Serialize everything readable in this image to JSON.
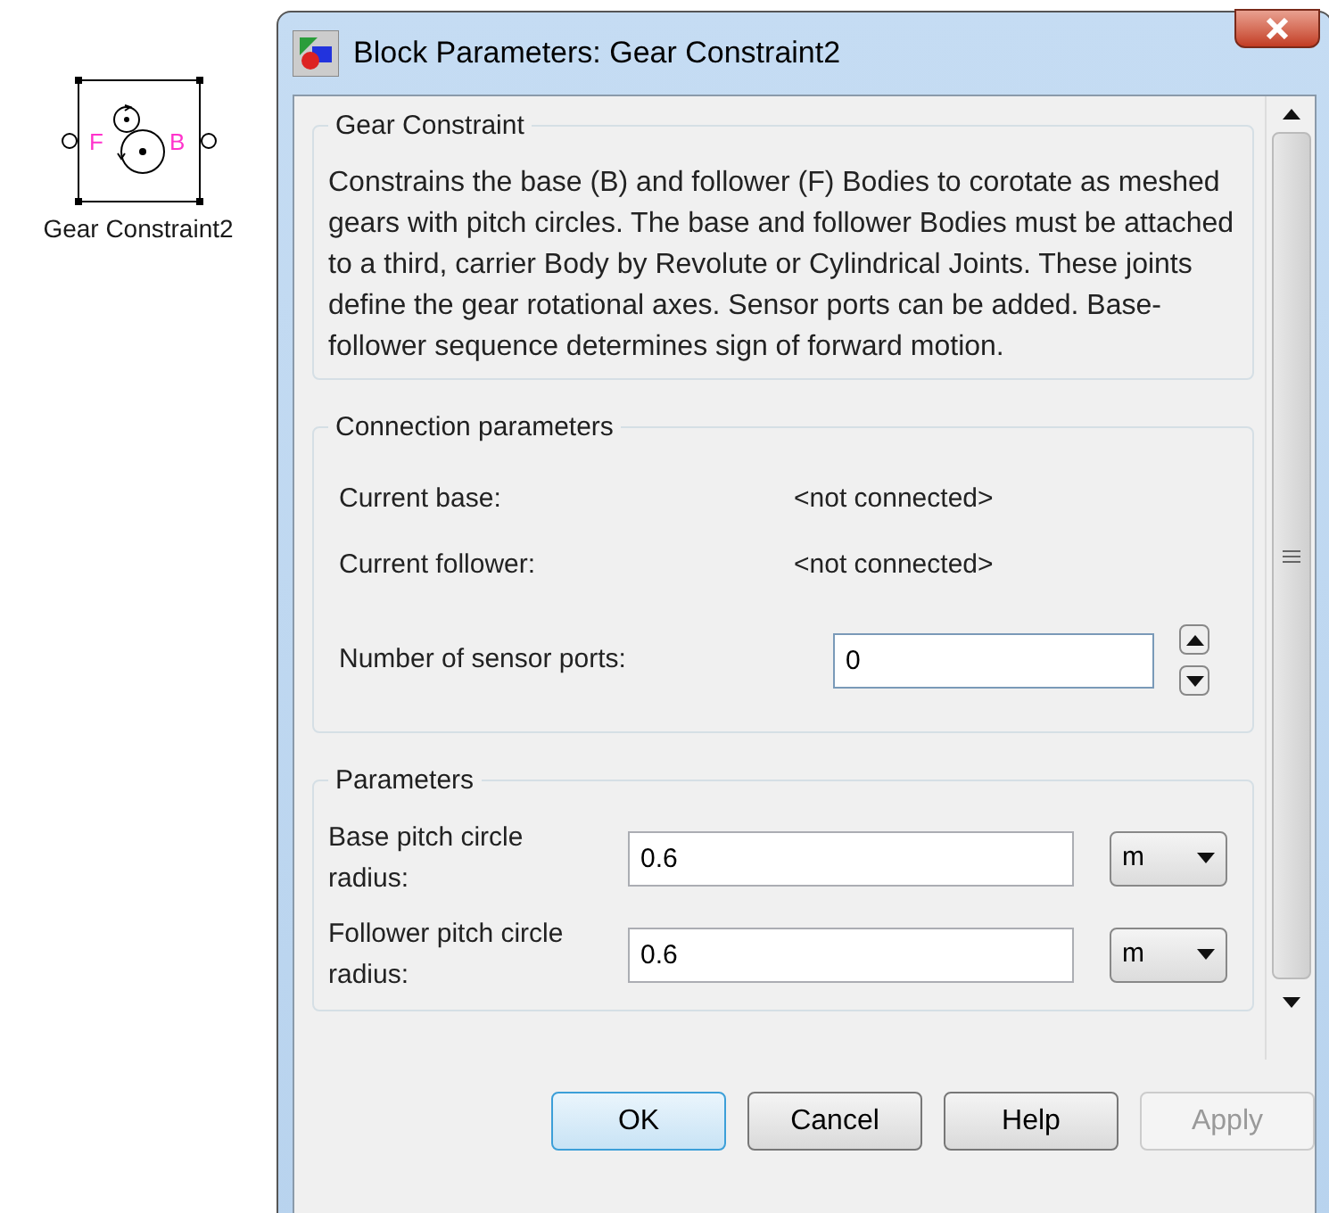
{
  "block": {
    "label": "Gear Constraint2",
    "port_left": "F",
    "port_right": "B"
  },
  "window": {
    "title": "Block Parameters: Gear Constraint2"
  },
  "description": {
    "title": "Gear Constraint",
    "text": "Constrains the base (B) and follower (F) Bodies to corotate as meshed gears with pitch circles. The base and follower Bodies must be attached to a third, carrier Body by Revolute or Cylindrical Joints. These joints define the gear rotational axes. Sensor ports can be added. Base-follower sequence determines sign of forward motion."
  },
  "connection": {
    "title": "Connection parameters",
    "rows": [
      {
        "label": "Current base:",
        "value": "<not connected>"
      },
      {
        "label": "Current follower:",
        "value": "<not connected>"
      }
    ],
    "sensor_ports": {
      "label": "Number of sensor ports:",
      "value": "0"
    }
  },
  "parameters": {
    "title": "Parameters",
    "rows": [
      {
        "label": "Base pitch circle radius:",
        "value": "0.6",
        "unit": "m"
      },
      {
        "label": "Follower pitch circle radius:",
        "value": "0.6",
        "unit": "m"
      }
    ]
  },
  "buttons": [
    {
      "label": "OK",
      "default": true,
      "disabled": false
    },
    {
      "label": "Cancel",
      "default": false,
      "disabled": false
    },
    {
      "label": "Help",
      "default": false,
      "disabled": false
    },
    {
      "label": "Apply",
      "default": false,
      "disabled": true
    }
  ]
}
